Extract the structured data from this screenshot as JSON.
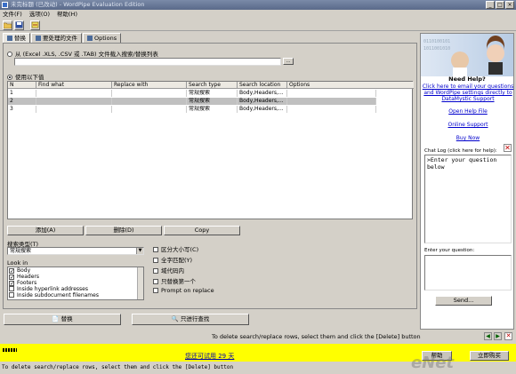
{
  "window": {
    "title": "未完标题 (已改动) - WordPipe Evaluation Edition"
  },
  "menu": [
    "文件(F)",
    "选项(O)",
    "帮助(H)"
  ],
  "tabs": [
    {
      "label": "替换",
      "active": true
    },
    {
      "label": "要处理的文件",
      "active": false
    },
    {
      "label": "Options",
      "active": false
    }
  ],
  "source": {
    "from_file_label": "从 (Excel .XLS, .CSV 或 .TAB) 文件载入搜索/替换列表",
    "browse_label": "...",
    "use_below_label": "使用以下值"
  },
  "grid": {
    "headers": [
      "N",
      "Find what",
      "Replace with",
      "Search type",
      "Search location",
      "Options"
    ],
    "rows": [
      {
        "n": "1",
        "find": "",
        "replace": "",
        "type": "常规搜索",
        "location": "Body,Headers,...",
        "options": "",
        "selected": false
      },
      {
        "n": "2",
        "find": "",
        "replace": "",
        "type": "常规搜索",
        "location": "Body,Headers,...",
        "options": "",
        "selected": true
      },
      {
        "n": "3",
        "find": "",
        "replace": "",
        "type": "常规搜索",
        "location": "Body,Headers,...",
        "options": "",
        "selected": false
      }
    ]
  },
  "grid_buttons": {
    "add": "添加(A)",
    "delete": "删除(D)",
    "copy": "Copy"
  },
  "search_type": {
    "label": "搜索类型(T)",
    "value": "常规搜索"
  },
  "look_in": {
    "label": "Look in",
    "items": [
      {
        "label": "Body",
        "checked": true
      },
      {
        "label": "Headers",
        "checked": true
      },
      {
        "label": "Footers",
        "checked": true
      },
      {
        "label": "Inside hyperlink addresses",
        "checked": false
      },
      {
        "label": "Inside subdocument filenames",
        "checked": false
      }
    ]
  },
  "options": [
    {
      "label": "区分大小写(C)",
      "checked": false
    },
    {
      "label": "全字匹配(Y)",
      "checked": false
    },
    {
      "label": "域代码内",
      "checked": false
    },
    {
      "label": "只替换第一个",
      "checked": false
    },
    {
      "label": "Prompt on replace",
      "checked": false
    }
  ],
  "actions": {
    "replace": "替换",
    "find_only": "只进行查找"
  },
  "help": {
    "title": "Need Help?",
    "email_link": "Click here to email your questions and WordPipe settings directly to DataMystic Support",
    "help_file": "Open Help File",
    "online_support": "Online Support",
    "buy_now": "Buy Now",
    "chat_label": "Chat Log (click here for help):",
    "chat_text": ">Enter your question below",
    "question_label": "Enter your question:",
    "send": "Send..."
  },
  "status": {
    "hint": "To delete search/replace rows, select them and click the [Delete] button"
  },
  "trial": {
    "text": "您还可试用 29 天",
    "help": "帮助",
    "buy": "立即购买"
  },
  "bottom": {
    "text": "To delete search/replace rows, select them and click the [Delete] button"
  },
  "watermark": "eNet"
}
